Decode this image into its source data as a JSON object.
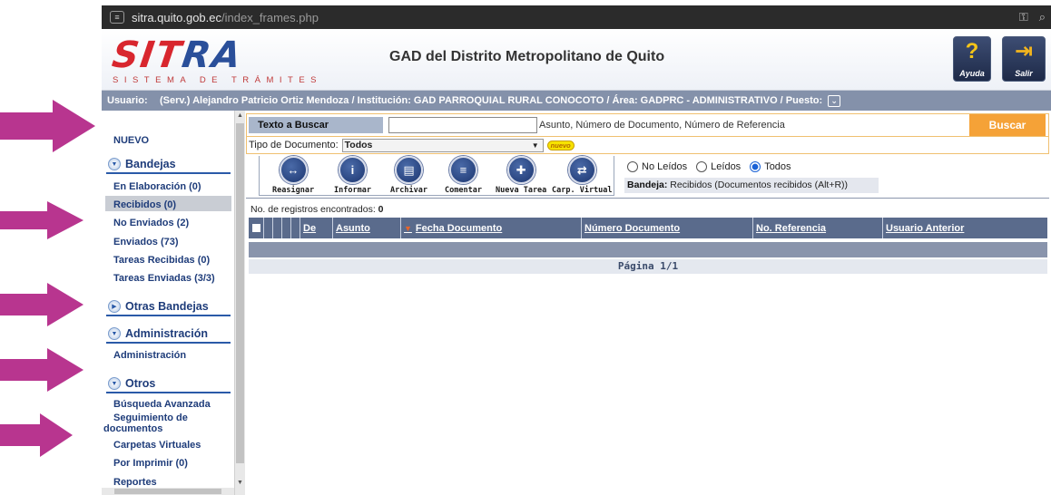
{
  "browser": {
    "url_host": "sitra.quito.gob.ec",
    "url_path": "/index_frames.php"
  },
  "header": {
    "logo_word_red": "SIT",
    "logo_word_blue": "RA",
    "logo_subtitle": "SISTEMA DE TRÁMITES",
    "org_title": "GAD del Distrito Metropolitano de Quito",
    "help_label": "Ayuda",
    "exit_label": "Salir"
  },
  "user_bar": {
    "label": "Usuario:",
    "value": "(Serv.) Alejandro Patricio Ortiz Mendoza / Institución: GAD PARROQUIAL RURAL CONOCOTO / Área: GADPRC - ADMINISTRATIVO / Puesto:"
  },
  "sidebar": {
    "nuevo": "NUEVO",
    "sections": {
      "bandejas": "Bandejas",
      "otras_bandejas": "Otras Bandejas",
      "administracion": "Administración",
      "otros": "Otros"
    },
    "bandejas_items": [
      "En Elaboración (0)",
      "Recibidos (0)",
      "No Enviados (2)",
      "Enviados (73)",
      "Tareas Recibidas (0)",
      "Tareas Enviadas (3/3)"
    ],
    "admin_items": [
      "Administración"
    ],
    "otros_items": [
      "Búsqueda Avanzada",
      "Seguimiento de",
      "documentos",
      "Carpetas Virtuales",
      "Por Imprimir (0)",
      "Reportes"
    ],
    "active_item": "Recibidos (0)"
  },
  "search": {
    "label": "Texto a Buscar",
    "value": "",
    "hint": "Asunto, Número de Documento, Número de Referencia",
    "button": "Buscar"
  },
  "tipo": {
    "label": "Tipo de Documento:",
    "selected": "Todos",
    "badge": "nuevo"
  },
  "toolbar": {
    "buttons": [
      {
        "label": "Reasignar",
        "glyph": "↔"
      },
      {
        "label": "Informar",
        "glyph": "i"
      },
      {
        "label": "Archivar",
        "glyph": "▤"
      },
      {
        "label": "Comentar",
        "glyph": "≡"
      },
      {
        "label": "Nueva Tarea",
        "glyph": "✚"
      },
      {
        "label": "Carp. Virtual",
        "glyph": "⇄"
      }
    ]
  },
  "filters": {
    "options": [
      "No Leídos",
      "Leídos",
      "Todos"
    ],
    "selected": "Todos"
  },
  "bandeja_info": {
    "label": "Bandeja:",
    "value": "Recibidos (Documentos recibidos (Alt+R))"
  },
  "results": {
    "count_text": "No. de registros encontrados:",
    "count_value": "0",
    "columns": [
      "De",
      "Asunto",
      "Fecha Documento",
      "Número Documento",
      "No. Referencia",
      "Usuario Anterior"
    ],
    "pager": "Página 1/1"
  },
  "colors": {
    "arrow": "#b8358f",
    "accent_orange": "#f5a237",
    "header_blue": "#5a6b8c",
    "nav_blue": "#1e3c7a"
  }
}
